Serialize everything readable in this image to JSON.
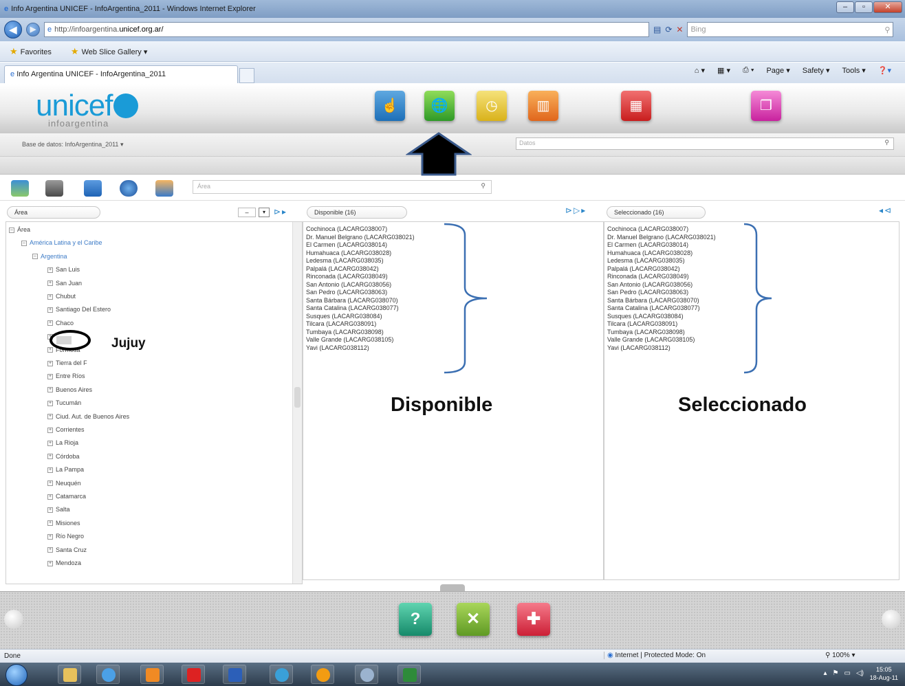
{
  "browser": {
    "title": "Info Argentina UNICEF - InfoArgentina_2011 - Windows Internet Explorer",
    "url_prefix": "http://infoargentina.",
    "url_domain": "unicef.org.ar/",
    "search_placeholder": "Bing",
    "favorites_label": "Favorites",
    "web_slice_label": "Web Slice Gallery ▾",
    "tab_label": "Info Argentina UNICEF - InfoArgentina_2011",
    "cmd": {
      "page": "Page ▾",
      "safety": "Safety ▾",
      "tools": "Tools ▾"
    }
  },
  "app": {
    "logo_text": "unicef",
    "logo_sub": "infoargentina",
    "db_label": "Base de datos:  InfoArgentina_2011 ▾",
    "datos_placeholder": "Datos",
    "area_search_placeholder": "Área"
  },
  "left_panel": {
    "field_label": "Área",
    "tree": [
      {
        "label": "Área",
        "level": 0
      },
      {
        "label": "América Latina y el Caribe",
        "level": 1
      },
      {
        "label": "Argentina",
        "level": 2
      },
      {
        "label": "San Luis",
        "level": 3
      },
      {
        "label": "San Juan",
        "level": 3
      },
      {
        "label": "Chubut",
        "level": 3
      },
      {
        "label": "Santiago Del Estero",
        "level": 3
      },
      {
        "label": "Chaco",
        "level": 3
      },
      {
        "label": "",
        "level": 3
      },
      {
        "label": "Formosa",
        "level": 3
      },
      {
        "label": "Tierra del F",
        "level": 3
      },
      {
        "label": "Entre Ríos",
        "level": 3
      },
      {
        "label": "Buenos Aires",
        "level": 3
      },
      {
        "label": "Tucumán",
        "level": 3
      },
      {
        "label": "Ciud. Aut. de Buenos Aires",
        "level": 3
      },
      {
        "label": "Corrientes",
        "level": 3
      },
      {
        "label": "La Rioja",
        "level": 3
      },
      {
        "label": "Córdoba",
        "level": 3
      },
      {
        "label": "La Pampa",
        "level": 3
      },
      {
        "label": "Neuquén",
        "level": 3
      },
      {
        "label": "Catamarca",
        "level": 3
      },
      {
        "label": "Salta",
        "level": 3
      },
      {
        "label": "Misiones",
        "level": 3
      },
      {
        "label": "Río Negro",
        "level": 3
      },
      {
        "label": "Santa Cruz",
        "level": 3
      },
      {
        "label": "Mendoza",
        "level": 3
      }
    ]
  },
  "middle_panel": {
    "header": "Disponible (16)",
    "items": [
      "Cochinoca (LACARG038007)",
      "Dr. Manuel Belgrano (LACARG038021)",
      "El Carmen (LACARG038014)",
      "Humahuaca (LACARG038028)",
      "Ledesma (LACARG038035)",
      "Palpalá (LACARG038042)",
      "Rinconada (LACARG038049)",
      "San Antonio (LACARG038056)",
      "San Pedro (LACARG038063)",
      "Santa Bárbara (LACARG038070)",
      "Santa Catalina (LACARG038077)",
      "Susques (LACARG038084)",
      "Tilcara (LACARG038091)",
      "Tumbaya (LACARG038098)",
      "Valle Grande (LACARG038105)",
      "Yavi (LACARG038112)"
    ]
  },
  "right_panel": {
    "header": "Seleccionado (16)",
    "items": [
      "Cochinoca (LACARG038007)",
      "Dr. Manuel Belgrano (LACARG038021)",
      "El Carmen (LACARG038014)",
      "Humahuaca (LACARG038028)",
      "Ledesma (LACARG038035)",
      "Palpalá (LACARG038042)",
      "Rinconada (LACARG038049)",
      "San Antonio (LACARG038056)",
      "San Pedro (LACARG038063)",
      "Santa Bárbara (LACARG038070)",
      "Santa Catalina (LACARG038077)",
      "Susques (LACARG038084)",
      "Tilcara (LACARG038091)",
      "Tumbaya (LACARG038098)",
      "Valle Grande (LACARG038105)",
      "Yavi (LACARG038112)"
    ]
  },
  "annotations": {
    "jujuy": "Jujuy",
    "disponible": "Disponible",
    "seleccionado": "Seleccionado"
  },
  "status": {
    "done": "Done",
    "zone": "Internet | Protected Mode: On",
    "zoom": "100% ▾"
  },
  "taskbar": {
    "time": "15:05",
    "date": "18-Aug-11"
  }
}
